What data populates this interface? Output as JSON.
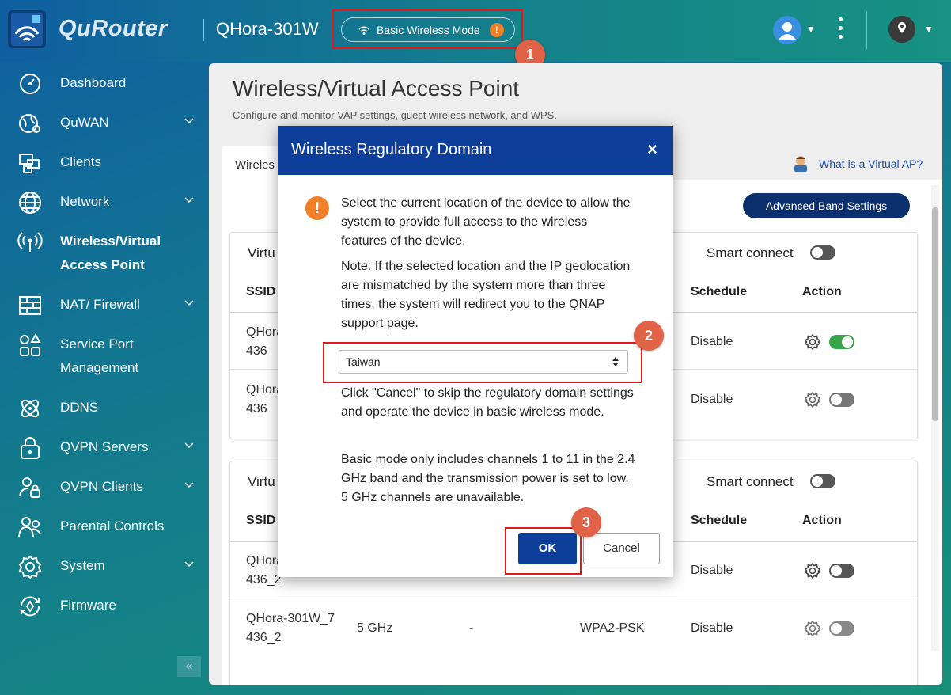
{
  "header": {
    "brand": "QuRouter",
    "model": "QHora-301W",
    "mode_label": "Basic Wireless Mode"
  },
  "annotations": {
    "step1": "1",
    "step2": "2",
    "step3": "3"
  },
  "sidebar": {
    "items": [
      {
        "label": "Dashboard"
      },
      {
        "label": "QuWAN"
      },
      {
        "label": "Clients"
      },
      {
        "label": "Network"
      },
      {
        "label": "Wireless/Virtual Access Point"
      },
      {
        "label": "NAT/ Firewall"
      },
      {
        "label": "Service Port Management"
      },
      {
        "label": "DDNS"
      },
      {
        "label": "QVPN Servers"
      },
      {
        "label": "QVPN Clients"
      },
      {
        "label": "Parental Controls"
      },
      {
        "label": "System"
      },
      {
        "label": "Firmware"
      }
    ],
    "collapse_label": "«"
  },
  "main": {
    "title": "Wireless/Virtual Access Point",
    "description": "Configure and monitor VAP settings, guest wireless network, and WPS.",
    "tab_label": "Wireles",
    "help_link": "What is a Virtual AP?",
    "advanced_button": "Advanced Band Settings",
    "card1": {
      "title": "Virtu",
      "smart_connect": "Smart connect",
      "columns": {
        "ssid": "SSID",
        "schedule": "Schedule",
        "action": "Action"
      },
      "rows": [
        {
          "ssid_line1": "QHora",
          "ssid_line2": "436",
          "schedule": "Disable"
        },
        {
          "ssid_line1": "QHora",
          "ssid_line2": "436",
          "schedule": "Disable"
        }
      ]
    },
    "card2": {
      "title": "Virtu",
      "smart_connect": "Smart connect",
      "columns": {
        "ssid": "SSID",
        "schedule": "Schedule",
        "action": "Action"
      },
      "rows": [
        {
          "ssid_line1": "QHora",
          "ssid_line2": "436_2",
          "schedule": "Disable"
        },
        {
          "ssid_line1": "QHora-301W_7",
          "ssid_line2": "436_2",
          "band": "5 GHz",
          "dash": "-",
          "security": "WPA2-PSK",
          "schedule": "Disable"
        }
      ]
    }
  },
  "modal": {
    "title": "Wireless Regulatory Domain",
    "close": "×",
    "paragraph1": "Select the current location of the device to allow the system to provide full access to the wireless features of the device.",
    "paragraph2": "Note: If the selected location and the IP geolocation are mismatched by the system more than three times, the system will redirect you to the QNAP support page.",
    "select_value": "Taiwan",
    "paragraph3": "Click \"Cancel\" to skip the regulatory domain settings and operate the device in basic wireless mode.",
    "paragraph4": "Basic mode only includes channels 1 to 11 in the 2.4 GHz band and the transmission power is set to low. 5 GHz channels are unavailable.",
    "ok_label": "OK",
    "cancel_label": "Cancel"
  },
  "colors": {
    "modal_header": "#0d3f9a",
    "accent_warning": "#f07f28",
    "annotation_red": "#e01a1a",
    "annotation_badge": "#e06247",
    "toggle_on": "#37a54a"
  }
}
